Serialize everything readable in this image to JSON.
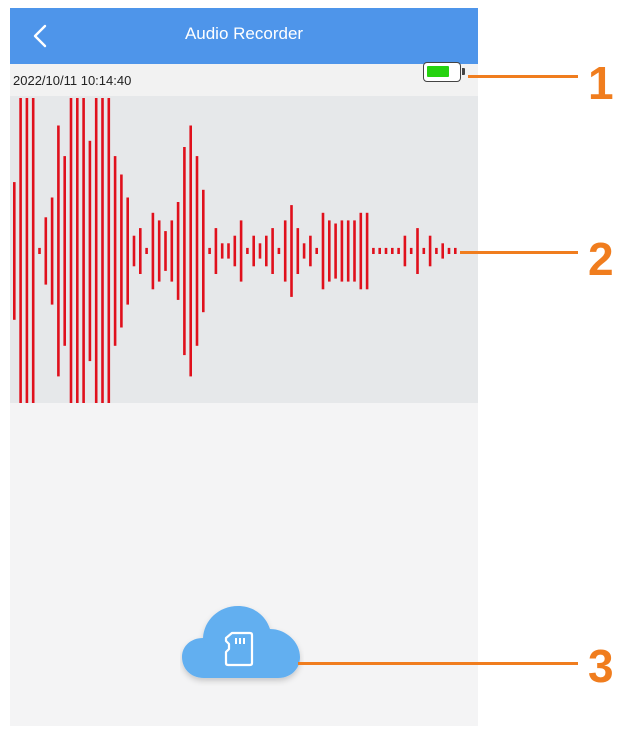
{
  "app": {
    "title": "Audio Recorder",
    "back_icon": "chevron-left-icon"
  },
  "status": {
    "timestamp": "2022/10/11 10:14:40",
    "battery_level": 0.75,
    "battery_icon": "battery-icon"
  },
  "waveform": {
    "color": "#e0101c",
    "amplitudes": [
      0.45,
      1.0,
      1.0,
      1.0,
      0.02,
      0.22,
      0.35,
      0.82,
      0.62,
      1.0,
      1.0,
      1.0,
      0.72,
      1.0,
      1.0,
      1.0,
      0.62,
      0.5,
      0.35,
      0.1,
      0.15,
      0.02,
      0.25,
      0.2,
      0.13,
      0.2,
      0.32,
      0.68,
      0.82,
      0.62,
      0.4,
      0.02,
      0.15,
      0.05,
      0.05,
      0.1,
      0.2,
      0.02,
      0.1,
      0.05,
      0.1,
      0.15,
      0.02,
      0.2,
      0.3,
      0.15,
      0.05,
      0.1,
      0.02,
      0.25,
      0.2,
      0.18,
      0.2,
      0.2,
      0.2,
      0.25,
      0.25,
      0.02,
      0.02,
      0.02,
      0.02,
      0.02,
      0.1,
      0.02,
      0.15,
      0.02,
      0.1,
      0.02,
      0.05,
      0.02,
      0.02
    ],
    "spacing": 6.3,
    "bar_width": 2.6
  },
  "actions": {
    "cloud_sd_icon": "cloud-sd-card-icon",
    "cloud_color": "#62aff0"
  },
  "callouts": {
    "color": "#f07d1e",
    "labels": [
      "1",
      "2",
      "3"
    ]
  }
}
